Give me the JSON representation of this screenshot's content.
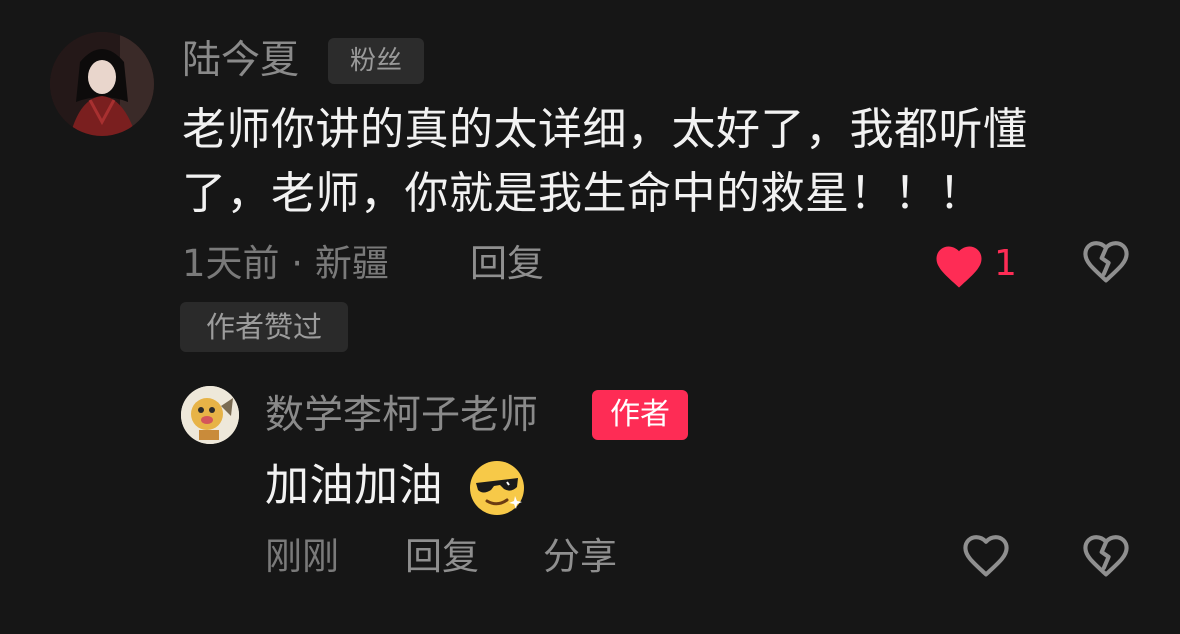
{
  "comment": {
    "author": "陆今夏",
    "author_badge": "粉丝",
    "text_line1": "老师你讲的真的太详细，太好了，我都听懂",
    "text_line2": "了，老师，你就是我生命中的救星！！！",
    "meta": "1天前 · 新疆",
    "reply_label": "回复",
    "like_count": "1",
    "liked_tag": "作者赞过",
    "colors": {
      "like": "#fe2c55",
      "badge_bg": "#2c2c2c"
    }
  },
  "reply": {
    "author": "数学李柯子老师",
    "author_badge": "作者",
    "text": "加油加油",
    "emoji": "cool-sunglasses-emoji",
    "time": "刚刚",
    "reply_label": "回复",
    "share_label": "分享",
    "colors": {
      "author_badge_bg": "#fe2c55"
    }
  },
  "icons": [
    "like-heart-icon",
    "dislike-broken-heart-icon",
    "like-outline-heart-icon"
  ]
}
